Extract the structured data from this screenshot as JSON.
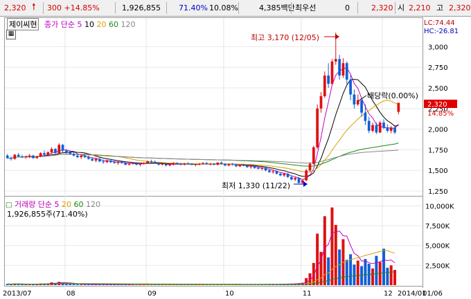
{
  "top_bar": {
    "price": "2,320",
    "change": "300 +14.85%",
    "volume": "1,926,855",
    "volume_ratio": "71.40%",
    "turnover": "10.08%",
    "amount": "4,385백만",
    "pref_label": "최우선",
    "pref_value": "0",
    "best_price": "2,320",
    "open_label": "시",
    "open_value": "2,210",
    "high_label": "고",
    "high_value": "2,320",
    "colors": {
      "up": "#d40000"
    }
  },
  "price_panel": {
    "stock_name": "제이씨현",
    "ma_label": "종가 단순 5",
    "ma_periods": [
      "10",
      "20",
      "60",
      "120"
    ],
    "ma_colors": {
      "ma5": "#c000c0",
      "ma10": "#000000",
      "ma20": "#d8a000",
      "ma60": "#1a8a1a",
      "ma120": "#888888"
    },
    "lc": "LC:74.44",
    "hc": "HC:-26.81",
    "current_price_tag": "2,320",
    "current_pct_tag": "14.85%",
    "annotations": {
      "high": "최고 3,170 (12/05)",
      "low": "최저 1,330 (11/22)",
      "dividend": "배당락(0.00%)"
    }
  },
  "volume_panel": {
    "label": "거래량 단순 5",
    "ma_periods": [
      "20",
      "60",
      "120"
    ],
    "value_text": "1,926,855주(71.40%)"
  },
  "x_axis": {
    "labels": [
      "2013/07",
      "08",
      "09",
      "10",
      "11",
      "12",
      "2014/01",
      "01/06"
    ]
  },
  "chart_data": {
    "type": "candlestick",
    "price_axis": {
      "ticks": [
        "3,000",
        "2,750",
        "2,500",
        "2,250",
        "2,000",
        "1,750",
        "1,500",
        "1,250"
      ],
      "ylim": [
        1200,
        3280
      ]
    },
    "volume_axis": {
      "ticks": [
        "10,000K",
        "7,500K",
        "5,000K",
        "2,500K"
      ],
      "ylim": [
        0,
        11000000
      ]
    },
    "colors": {
      "up": "#e01010",
      "down": "#1060d8"
    },
    "candles": [
      [
        1680,
        1700,
        1640,
        1650
      ],
      [
        1650,
        1670,
        1620,
        1640
      ],
      [
        1640,
        1700,
        1630,
        1690
      ],
      [
        1690,
        1710,
        1660,
        1670
      ],
      [
        1670,
        1690,
        1650,
        1660
      ],
      [
        1660,
        1680,
        1640,
        1670
      ],
      [
        1670,
        1700,
        1650,
        1680
      ],
      [
        1680,
        1690,
        1640,
        1650
      ],
      [
        1650,
        1680,
        1640,
        1670
      ],
      [
        1670,
        1720,
        1660,
        1710
      ],
      [
        1710,
        1740,
        1680,
        1690
      ],
      [
        1690,
        1730,
        1680,
        1720
      ],
      [
        1720,
        1780,
        1700,
        1760
      ],
      [
        1760,
        1770,
        1700,
        1710
      ],
      [
        1710,
        1830,
        1700,
        1810
      ],
      [
        1810,
        1820,
        1720,
        1740
      ],
      [
        1740,
        1760,
        1700,
        1720
      ],
      [
        1720,
        1740,
        1690,
        1700
      ],
      [
        1700,
        1720,
        1670,
        1680
      ],
      [
        1680,
        1700,
        1650,
        1660
      ],
      [
        1660,
        1690,
        1640,
        1680
      ],
      [
        1680,
        1700,
        1650,
        1660
      ],
      [
        1660,
        1680,
        1630,
        1640
      ],
      [
        1640,
        1660,
        1610,
        1620
      ],
      [
        1620,
        1650,
        1600,
        1640
      ],
      [
        1640,
        1660,
        1600,
        1610
      ],
      [
        1610,
        1630,
        1580,
        1600
      ],
      [
        1600,
        1630,
        1590,
        1620
      ],
      [
        1620,
        1640,
        1590,
        1600
      ],
      [
        1600,
        1620,
        1580,
        1590
      ],
      [
        1590,
        1610,
        1570,
        1600
      ],
      [
        1600,
        1620,
        1580,
        1590
      ],
      [
        1590,
        1600,
        1560,
        1570
      ],
      [
        1570,
        1590,
        1560,
        1580
      ],
      [
        1580,
        1600,
        1570,
        1590
      ],
      [
        1590,
        1600,
        1560,
        1570
      ],
      [
        1570,
        1590,
        1550,
        1580
      ],
      [
        1580,
        1600,
        1570,
        1590
      ],
      [
        1590,
        1620,
        1580,
        1610
      ],
      [
        1610,
        1630,
        1590,
        1600
      ],
      [
        1600,
        1620,
        1580,
        1590
      ],
      [
        1590,
        1600,
        1560,
        1570
      ],
      [
        1570,
        1590,
        1560,
        1580
      ],
      [
        1580,
        1590,
        1550,
        1560
      ],
      [
        1560,
        1580,
        1550,
        1570
      ],
      [
        1570,
        1600,
        1560,
        1590
      ],
      [
        1590,
        1600,
        1570,
        1580
      ],
      [
        1580,
        1590,
        1560,
        1570
      ],
      [
        1570,
        1590,
        1560,
        1585
      ],
      [
        1585,
        1600,
        1570,
        1580
      ],
      [
        1580,
        1590,
        1560,
        1570
      ],
      [
        1570,
        1580,
        1550,
        1575
      ],
      [
        1575,
        1590,
        1560,
        1580
      ],
      [
        1580,
        1600,
        1570,
        1590
      ],
      [
        1590,
        1600,
        1570,
        1575
      ],
      [
        1575,
        1590,
        1560,
        1580
      ],
      [
        1580,
        1590,
        1560,
        1570
      ],
      [
        1570,
        1600,
        1560,
        1595
      ],
      [
        1595,
        1610,
        1570,
        1580
      ],
      [
        1580,
        1590,
        1550,
        1560
      ],
      [
        1560,
        1580,
        1550,
        1575
      ],
      [
        1575,
        1590,
        1560,
        1570
      ],
      [
        1570,
        1580,
        1540,
        1550
      ],
      [
        1550,
        1570,
        1540,
        1565
      ],
      [
        1565,
        1580,
        1550,
        1560
      ],
      [
        1560,
        1570,
        1530,
        1540
      ],
      [
        1540,
        1560,
        1520,
        1550
      ],
      [
        1550,
        1560,
        1520,
        1530
      ],
      [
        1530,
        1550,
        1510,
        1520
      ],
      [
        1520,
        1540,
        1500,
        1530
      ],
      [
        1530,
        1540,
        1490,
        1500
      ],
      [
        1500,
        1520,
        1470,
        1480
      ],
      [
        1480,
        1500,
        1460,
        1490
      ],
      [
        1490,
        1500,
        1450,
        1460
      ],
      [
        1460,
        1480,
        1430,
        1440
      ],
      [
        1440,
        1470,
        1420,
        1460
      ],
      [
        1460,
        1470,
        1410,
        1420
      ],
      [
        1420,
        1440,
        1380,
        1390
      ],
      [
        1390,
        1420,
        1370,
        1410
      ],
      [
        1410,
        1420,
        1340,
        1350
      ],
      [
        1350,
        1390,
        1330,
        1380
      ],
      [
        1380,
        1520,
        1370,
        1500
      ],
      [
        1500,
        1600,
        1480,
        1580
      ],
      [
        1580,
        1800,
        1570,
        1780
      ],
      [
        1780,
        2300,
        1760,
        2250
      ],
      [
        2250,
        2450,
        2200,
        2400
      ],
      [
        2400,
        2700,
        2380,
        2650
      ],
      [
        2650,
        2800,
        2500,
        2550
      ],
      [
        2550,
        2850,
        2540,
        2820
      ],
      [
        2820,
        3170,
        2780,
        2850
      ],
      [
        2850,
        2900,
        2600,
        2650
      ],
      [
        2650,
        2860,
        2620,
        2800
      ],
      [
        2800,
        2820,
        2550,
        2600
      ],
      [
        2600,
        2650,
        2350,
        2420
      ],
      [
        2420,
        2480,
        2250,
        2300
      ],
      [
        2300,
        2420,
        2280,
        2350
      ],
      [
        2350,
        2380,
        2150,
        2200
      ],
      [
        2200,
        2300,
        2050,
        2100
      ],
      [
        2100,
        2150,
        1950,
        1980
      ],
      [
        1980,
        2080,
        1960,
        2050
      ],
      [
        2050,
        2080,
        1940,
        1960
      ],
      [
        1960,
        2100,
        1950,
        2080
      ],
      [
        2080,
        2120,
        2000,
        2020
      ],
      [
        2020,
        2060,
        1960,
        1980
      ],
      [
        1980,
        2040,
        1950,
        2020
      ],
      [
        2020,
        2050,
        1940,
        1960
      ],
      [
        2210,
        2320,
        2180,
        2320
      ]
    ],
    "volumes": [
      150000,
      120000,
      180000,
      140000,
      100000,
      110000,
      130000,
      120000,
      150000,
      200000,
      180000,
      220000,
      350000,
      260000,
      420000,
      300000,
      200000,
      160000,
      140000,
      120000,
      110000,
      100000,
      120000,
      130000,
      110000,
      100000,
      90000,
      110000,
      100000,
      90000,
      80000,
      90000,
      100000,
      80000,
      90000,
      100000,
      90000,
      80000,
      110000,
      90000,
      80000,
      70000,
      90000,
      80000,
      70000,
      90000,
      80000,
      70000,
      80000,
      90000,
      70000,
      80000,
      90000,
      100000,
      80000,
      70000,
      80000,
      110000,
      90000,
      80000,
      70000,
      90000,
      80000,
      70000,
      80000,
      90000,
      80000,
      100000,
      90000,
      100000,
      110000,
      120000,
      100000,
      130000,
      150000,
      140000,
      160000,
      180000,
      200000,
      250000,
      300000,
      900000,
      1500000,
      2800000,
      6500000,
      4200000,
      8700000,
      3500000,
      9800000,
      7600000,
      4500000,
      5800000,
      3200000,
      3900000,
      2600000,
      3100000,
      2400000,
      3300000,
      2700000,
      2100000,
      3700000,
      2900000,
      4600000,
      2200000,
      2500000,
      1926855
    ],
    "bar_up": [
      false,
      false,
      true,
      false,
      false,
      true,
      true,
      false,
      true,
      true,
      false,
      true,
      true,
      false,
      true,
      false,
      false,
      false,
      false,
      false,
      true,
      false,
      false,
      false,
      true,
      false,
      false,
      true,
      false,
      false,
      true,
      false,
      false,
      true,
      true,
      false,
      true,
      true,
      true,
      false,
      false,
      false,
      true,
      false,
      true,
      true,
      false,
      false,
      true,
      false,
      false,
      true,
      true,
      true,
      false,
      true,
      false,
      true,
      false,
      false,
      true,
      false,
      false,
      true,
      false,
      false,
      true,
      false,
      false,
      true,
      false,
      false,
      true,
      false,
      false,
      true,
      false,
      false,
      true,
      false,
      true,
      true,
      true,
      true,
      true,
      true,
      true,
      false,
      true,
      true,
      false,
      true,
      false,
      false,
      false,
      true,
      false,
      false,
      false,
      true,
      false,
      true,
      false,
      false,
      true,
      true
    ]
  }
}
